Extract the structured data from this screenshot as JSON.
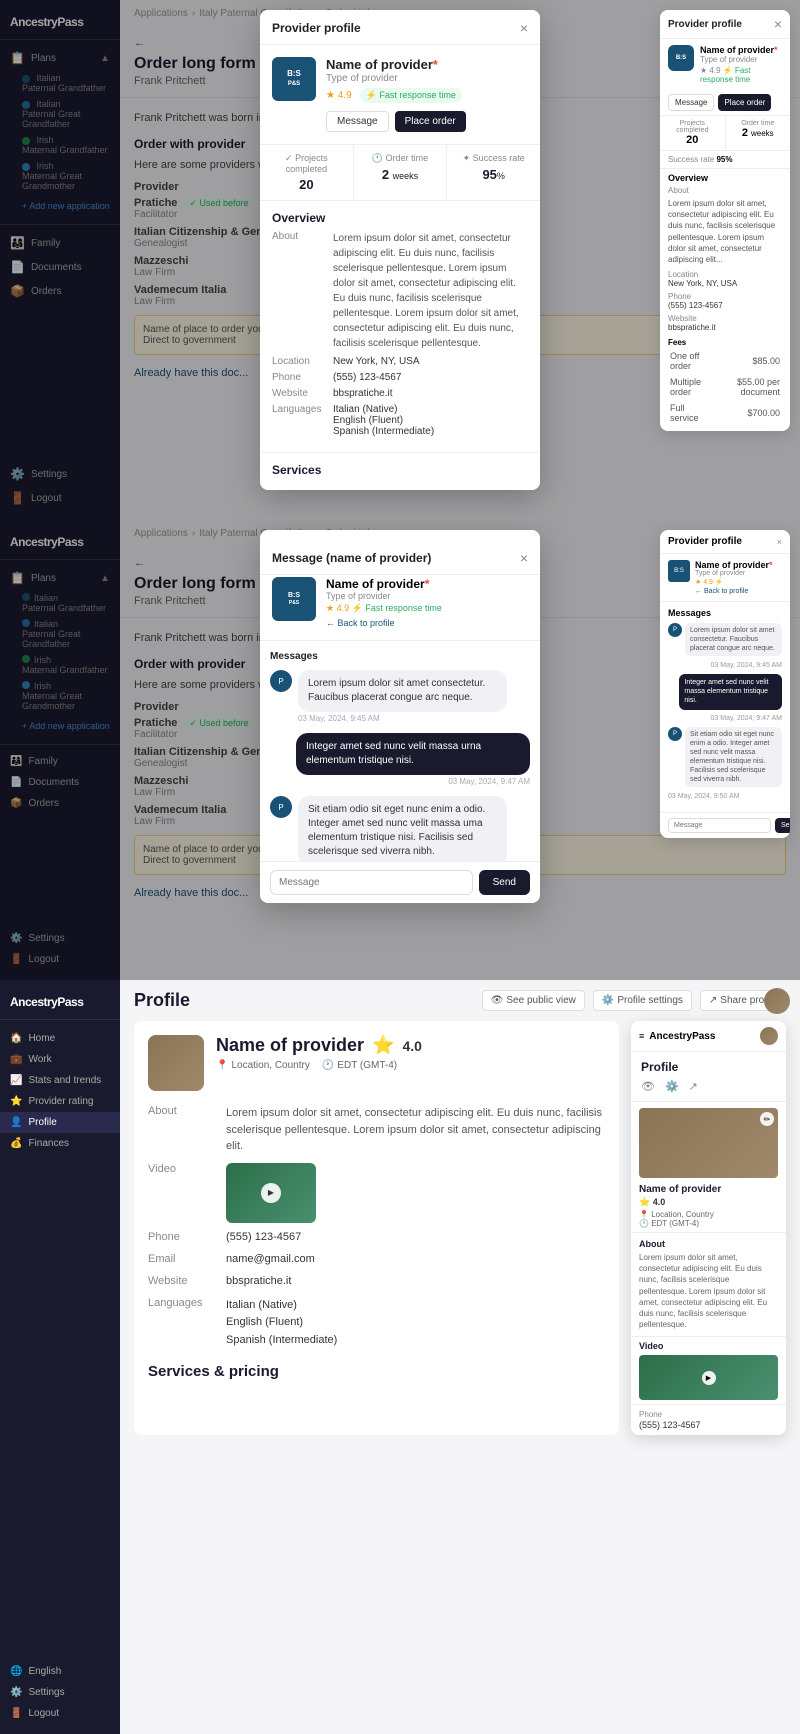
{
  "app": {
    "name": "AncestryPass"
  },
  "section1": {
    "breadcrumb": [
      "Applications",
      "Italy Paternal Grandfather",
      "Order birth cer..."
    ],
    "page_title": "Order long form birth certific...",
    "page_sub": "Frank Pritchett",
    "back_label": "← ",
    "order_text": "Frank Pritchett was born in...",
    "order_section": "Order with provider",
    "order_desc": "Here are some providers who can help you request the long-form birth...",
    "provider_label": "Provider",
    "providers": [
      {
        "name": "Pratiche",
        "type": "Facilitator",
        "used_before": true
      },
      {
        "name": "Italian Citizenship & Genea...",
        "type": "Genealogist",
        "used_before": false
      },
      {
        "name": "Mazzeschi",
        "type": "Law Firm",
        "used_before": false
      },
      {
        "name": "Vademecum Italia",
        "type": "Law Firm",
        "used_before": false
      }
    ],
    "note": "Name of place to order you...\nDirect to government",
    "already_have": "Already have this doc..."
  },
  "sidebar": {
    "items": [
      {
        "icon": "📋",
        "label": "Plans"
      },
      {
        "icon": "👨‍👩‍👧",
        "label": "Family"
      },
      {
        "icon": "📄",
        "label": "Documents"
      },
      {
        "icon": "📦",
        "label": "Orders"
      },
      {
        "icon": "⚙️",
        "label": "Settings"
      },
      {
        "icon": "🚪",
        "label": "Logout"
      }
    ],
    "plans_sub": [
      "Italian\nPaternal Grandfather",
      "Italian\nPaternal Great Grandfather",
      "Irish\nMaternal Grandfather",
      "Irish\nMaternal Great Grandmother"
    ],
    "add_new": "+ Add new application"
  },
  "provider_modal": {
    "title": "Provider profile",
    "logo_text": "B:S",
    "provider_name": "Name of provider",
    "required_mark": "*",
    "provider_type": "Type of provider",
    "rating": "4.9",
    "fast_badge": "⚡ Fast response time",
    "btn_message": "Message",
    "btn_place": "Place order",
    "stats": [
      {
        "label": "Projects completed",
        "icon": "✓",
        "value": "20"
      },
      {
        "label": "Order time",
        "icon": "🕐",
        "value": "2",
        "unit": " weeks"
      },
      {
        "label": "Success rate",
        "icon": "✦",
        "value": "95",
        "unit": "%"
      }
    ],
    "overview_title": "Overview",
    "about_title": "About",
    "about_text": "Lorem ipsum dolor sit amet, consectetur adipiscing elit. Eu duis nunc, facilisis scelerisque pellentesque. Lorem ipsum dolor sit amet, consectetur adipiscing elit. Eu duis nunc, facilisis scelerisque pellentesque. Lorem ipsum dolor sit amet, consectetur adipiscing elit. Eu duis nunc, facilisis scelerisque pellentesque.",
    "location_label": "Location",
    "location_value": "New York, NY, USA",
    "phone_label": "Phone",
    "phone_value": "(555) 123-4567",
    "website_label": "Website",
    "website_value": "bbspratiche.it",
    "languages_label": "Languages",
    "languages_value": "Italian (Native)\nEnglish (Fluent)\nSpanish (Intermediate)",
    "services_title": "Services",
    "fees_title": "Fees",
    "fees": [
      {
        "label": "One off order",
        "value": "$85.00"
      },
      {
        "label": "Multiple order",
        "value": "$55.00 per document"
      },
      {
        "label": "Full service",
        "value": "$700.00"
      }
    ]
  },
  "message_modal": {
    "title": "Message (name of provider)",
    "close": "×",
    "provider_name": "Name of provider",
    "required_mark": "*",
    "provider_type": "Type of provider",
    "rating": "4.9",
    "fast_badge": "⚡ Fast response time",
    "back_to_profile": "← Back to profile",
    "messages_label": "Messages",
    "messages": [
      {
        "type": "received",
        "text": "Lorem ipsum dolor sit amet consectetur. Faucibus placerat congue arc neque.",
        "time": "03 May, 2024, 9:45 AM"
      },
      {
        "type": "sent",
        "text": "Integer amet sed nunc velit massa urna elementum tristique nisi.",
        "time": "03 May, 2024, 9:47 AM"
      },
      {
        "type": "received",
        "text": "Sit etiam odio sit eget nunc enim a odio. Integer amet sed nunc velit massa uma elementum tristique nisi. Facilisis sed scelerisque sed viverra nibh.",
        "time": "03 May, 2024, 9:50 AM"
      }
    ],
    "input_placeholder": "Message",
    "send_label": "Send"
  },
  "section3": {
    "breadcrumb": [],
    "profile_title": "Profile",
    "action_public": "See public view",
    "action_settings": "Profile settings",
    "action_share": "Share profile",
    "sidebar_items": [
      {
        "icon": "🏠",
        "label": "Home"
      },
      {
        "icon": "💼",
        "label": "Work"
      },
      {
        "icon": "📈",
        "label": "Stats and trends"
      },
      {
        "icon": "⭐",
        "label": "Provider rating"
      },
      {
        "icon": "👤",
        "label": "Profile"
      },
      {
        "icon": "💰",
        "label": "Finances"
      }
    ],
    "provider_name": "Name of provider",
    "provider_rating": "4.0",
    "provider_location": "Location, Country",
    "provider_timezone": "EDT (GMT-4)",
    "about_label": "About",
    "about_text": "Lorem ipsum dolor sit amet, consectetur adipiscing elit. Eu duis nunc, facilisis scelerisque pellentesque. Lorem ipsum dolor sit amet, consectetur adipiscing elit.",
    "video_label": "Video",
    "phone_label": "Phone",
    "phone_value": "(555) 123-4567",
    "email_label": "Email",
    "email_value": "name@gmail.com",
    "website_label": "Website",
    "website_value": "bbspratiche.it",
    "languages_label": "Languages",
    "languages_value": "Italian (Native)\nEnglish (Fluent)\nSpanish (Intermediate)",
    "services_title": "Services & pricing",
    "side_modal": {
      "header": "AncestryPass",
      "section": "Profile",
      "provider_name": "Name of provider",
      "rating": "⭐ 4.0",
      "location": "Location, Country",
      "timezone": "EDT (GMT-4)",
      "about_title": "About",
      "about_text": "Lorem ipsum dolor sit amet, consectetur adipiscing elit. Eu duis nunc, facilisis scelerisque pellentesque. Lorem ipsum dolor sit amet, consectetur adipiscing elit. Eu duis nunc, facilisis scelerisque pellentesque.",
      "video_label": "Video",
      "phone_label": "Phone",
      "phone_value": "(555) 123-4567"
    },
    "lang_bottom": "English",
    "settings_bottom": "Settings",
    "logout_bottom": "Logout"
  }
}
